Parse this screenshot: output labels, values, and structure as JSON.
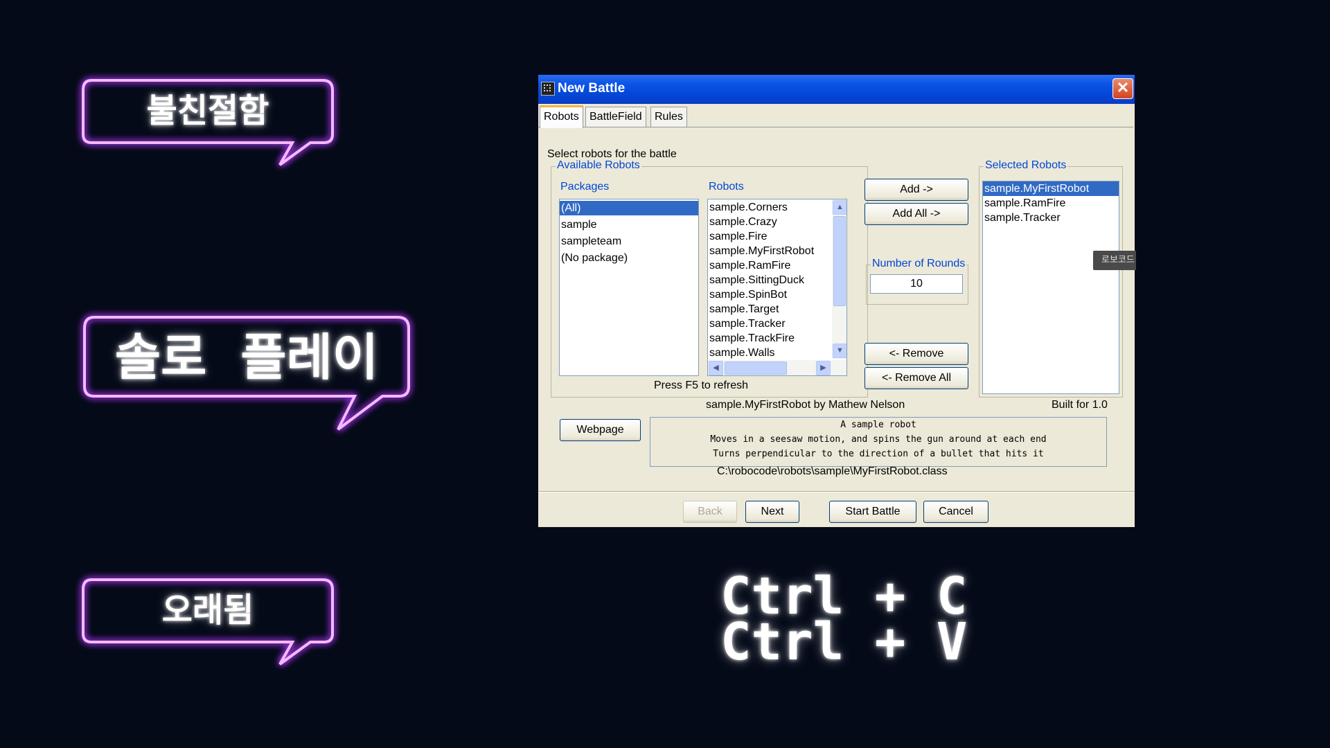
{
  "bubbles": [
    {
      "text": "불친절함"
    },
    {
      "text": "솔로 플레이"
    },
    {
      "text": "오래됨"
    }
  ],
  "shortcut": {
    "line1": "Ctrl + C",
    "line2": "Ctrl + V"
  },
  "window": {
    "title": "New Battle",
    "close_label": "✕",
    "tabs": [
      "Robots",
      "BattleField",
      "Rules"
    ],
    "active_tab": "Robots",
    "instruction": "Select robots for the battle",
    "available_group": "Available Robots",
    "packages_label": "Packages",
    "robots_label": "Robots",
    "packages": [
      "(All)",
      "sample",
      "sampleteam",
      "(No package)"
    ],
    "selected_package": "(All)",
    "robots": [
      "sample.Corners",
      "sample.Crazy",
      "sample.Fire",
      "sample.MyFirstRobot",
      "sample.RamFire",
      "sample.SittingDuck",
      "sample.SpinBot",
      "sample.Target",
      "sample.Tracker",
      "sample.TrackFire",
      "sample.Walls"
    ],
    "refresh_hint": "Press F5 to refresh",
    "add_button": "Add ->",
    "add_all_button": "Add All ->",
    "rounds_label": "Number of Rounds",
    "rounds_value": "10",
    "remove_button": "<- Remove",
    "remove_all_button": "<- Remove All",
    "selected_group": "Selected Robots",
    "selected_robots": [
      "sample.MyFirstRobot",
      "sample.RamFire",
      "sample.Tracker"
    ],
    "selected_highlight": "sample.MyFirstRobot",
    "robot_info": "sample.MyFirstRobot by Mathew Nelson",
    "built_for": "Built for 1.0",
    "webpage_button": "Webpage",
    "description_lines": [
      "A sample robot",
      "Moves in a seesaw motion, and spins the gun around at each end",
      "Turns perpendicular to the direction of a bullet that hits it"
    ],
    "file_path": "C:\\robocode\\robots\\sample\\MyFirstRobot.class",
    "back_button": "Back",
    "next_button": "Next",
    "start_button": "Start Battle",
    "cancel_button": "Cancel"
  },
  "tooltip_text": "로보코드",
  "colors": {
    "neon": "#f6b8ff",
    "neon_glow": "#b03cff",
    "selection": "#316ac5",
    "title_blue": "#0446d6"
  }
}
